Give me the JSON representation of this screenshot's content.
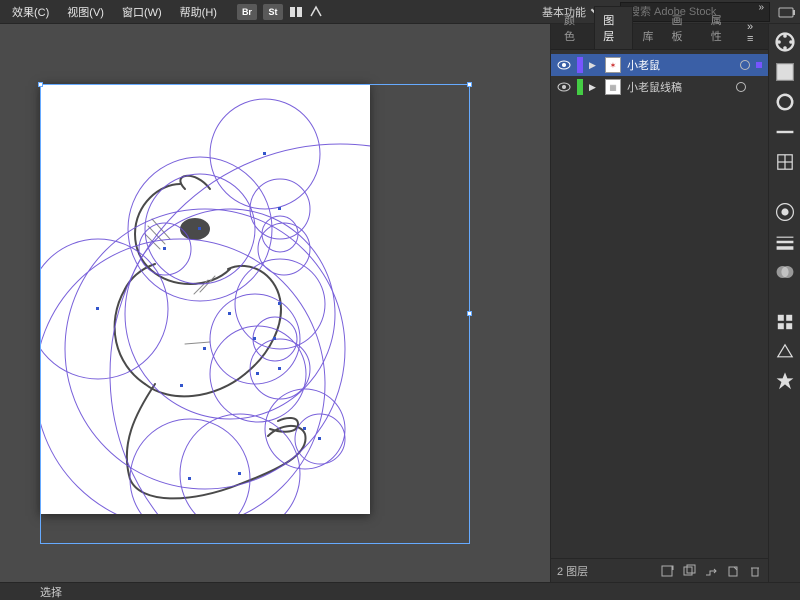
{
  "menu": {
    "effects": "效果(C)",
    "view": "视图(V)",
    "window": "窗口(W)",
    "help": "帮助(H)"
  },
  "header": {
    "workspace": "基本功能",
    "search_placeholder": "搜索 Adobe Stock",
    "br_badge": "Br",
    "st_badge": "St"
  },
  "panel": {
    "tabs": [
      "颜色",
      "图层",
      "库",
      "画板",
      "属性"
    ],
    "active_tab": "图层",
    "footer_count": "2 图层"
  },
  "layers": [
    {
      "name": "小老鼠",
      "selected": true
    },
    {
      "name": "小老鼠线稿",
      "selected": false
    }
  ],
  "status": {
    "tool": "选择"
  },
  "colors": {
    "circle_stroke": "#6a4fd6",
    "sketch_stroke": "#2b2b2b",
    "anchor": "#3355cc"
  }
}
